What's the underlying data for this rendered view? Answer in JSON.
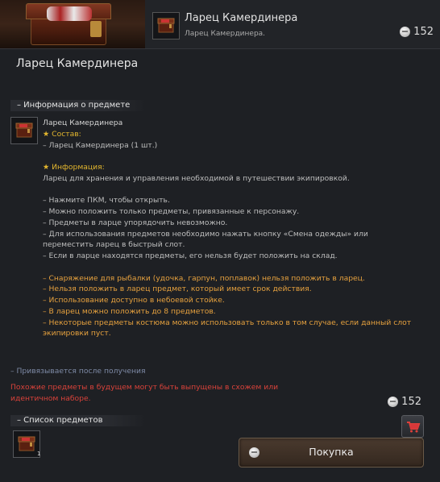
{
  "header": {
    "title": "Ларец Камердинера",
    "subtitle": "Ларец Камердинера.",
    "price": "152"
  },
  "panel": {
    "title": "Ларец Камердинера"
  },
  "info_section": {
    "label": "– Информация о предмете"
  },
  "item": {
    "name": "Ларец Камердинера",
    "contents_head": "★ Состав:",
    "contents_line": "– Ларец Камердинера (1 шт.)",
    "info_head": "★ Информация:",
    "info_text": "Ларец для хранения и управления необходимой в путешествии экипировкой.",
    "gray_lines": [
      "– Нажмите ПКМ, чтобы открыть.",
      "– Можно положить только предметы, привязанные к персонажу.",
      "– Предметы в ларце упорядочить невозможно.",
      "– Для использования предметов необходимо нажать кнопку «Смена одежды» или",
      "переместить ларец в быстрый слот.",
      "– Если в ларце находятся предметы, его нельзя будет положить на склад."
    ],
    "orange_lines": [
      "– Снаряжение для рыбалки (удочка, гарпун, поплавок) нельзя положить в ларец.",
      "– Нельзя положить в ларец предмет, который имеет срок действия.",
      "– Использование доступно в небоевой стойке.",
      "– В ларец можно положить до 8 предметов.",
      "– Некоторые предметы костюма можно использовать только в том случае, если данный слот",
      "экипировки пуст."
    ]
  },
  "bind_note": "– Привязывается после получения",
  "warning": "Похожие предметы в будущем могут быть выпущены в схожем или идентичном наборе.",
  "price_bottom": "152",
  "list_section": {
    "label": "– Список предметов"
  },
  "list_item": {
    "count": "1"
  },
  "buy_button": {
    "label": "Покупка"
  },
  "icons": {
    "currency": "silver-coin-icon",
    "cart": "shopping-cart-icon",
    "chest": "chest-icon"
  },
  "colors": {
    "yellow": "#e3b62e",
    "orange": "#e6a13e",
    "warning": "#d8423a",
    "bind_note": "#7e8aa6"
  }
}
